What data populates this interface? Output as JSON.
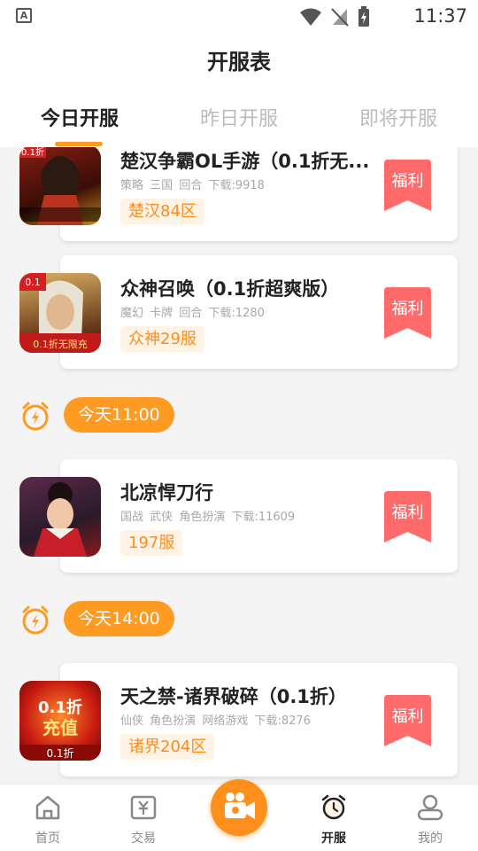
{
  "status_bar": {
    "time": "11:37",
    "a_label": "A"
  },
  "header": {
    "title": "开服表"
  },
  "tabs": [
    {
      "label": "今日开服",
      "active": true
    },
    {
      "label": "昨日开服",
      "active": false
    },
    {
      "label": "即将开服",
      "active": false
    }
  ],
  "games": [
    {
      "name": "楚汉争霸OL手游（0.1折无...",
      "tags": [
        "策略",
        "三国",
        "回合"
      ],
      "downloads": "下载:9918",
      "server": "楚汉84区",
      "fuli": "福利"
    },
    {
      "name": "众神召唤（0.1折超爽版）",
      "tags": [
        "魔幻",
        "卡牌",
        "回合"
      ],
      "downloads": "下载:1280",
      "server": "众神29服",
      "fuli": "福利"
    },
    {
      "name": "北凉悍刀行",
      "tags": [
        "国战",
        "武侠",
        "角色扮演"
      ],
      "downloads": "下载:11609",
      "server": "197服",
      "fuli": "福利"
    },
    {
      "name": "天之禁-诸界破碎（0.1折）",
      "tags": [
        "仙侠",
        "角色扮演",
        "网络游戏"
      ],
      "downloads": "下载:8276",
      "server": "诸界204区",
      "fuli": "福利"
    }
  ],
  "time_groups": [
    {
      "label": "今天11:00"
    },
    {
      "label": "今天14:00"
    }
  ],
  "icon_texts": {
    "chuhan": "0.1折",
    "zhongshen_top": "0.1",
    "zhongshen_bottom": "0.1折无限充",
    "tianzhijin_top": "0.1折",
    "tianzhijin_mid": "充值",
    "tianzhijin_bottom": "0.1折"
  },
  "bottom_nav": [
    {
      "label": "首页",
      "icon": "home-icon"
    },
    {
      "label": "交易",
      "icon": "trade-icon"
    },
    {
      "label": "",
      "icon": "video-camera-icon"
    },
    {
      "label": "开服",
      "icon": "alarm-clock-icon",
      "active": true
    },
    {
      "label": "我的",
      "icon": "user-icon"
    }
  ],
  "colors": {
    "accent": "#ff9a22",
    "fuli_ribbon": "#ff6b6b",
    "badge_bg": "#fff3e6",
    "badge_text": "#ff8c1a"
  }
}
